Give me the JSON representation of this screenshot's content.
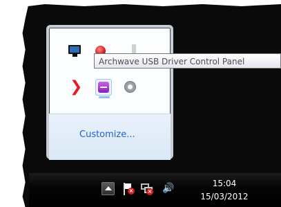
{
  "tooltip": {
    "text": "Archwave USB Driver Control Panel"
  },
  "flyout": {
    "icons": [
      {
        "name": "monitor-icon"
      },
      {
        "name": "red-ball-icon"
      },
      {
        "name": "arrow-app-icon"
      },
      {
        "name": "usb-driver-icon"
      },
      {
        "name": "gray-ring-icon"
      }
    ],
    "customize_label": "Customize..."
  },
  "taskbar": {
    "show_hidden_icon": "triangle-up-icon",
    "tray_icons": [
      "action-center-flag-icon",
      "network-icon",
      "volume-icon"
    ],
    "clock": {
      "time": "15:04",
      "date": "15/03/2012"
    }
  },
  "colors": {
    "link": "#1a64c8",
    "desktop": "#0a0a0a",
    "flyout_border": "#c5ccd6"
  }
}
